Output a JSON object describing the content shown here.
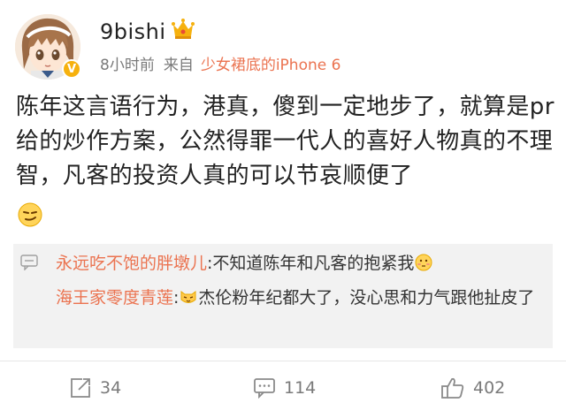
{
  "post": {
    "username": "9bishi",
    "time": "8小时前",
    "source_prefix": "来自",
    "source": "少女裙底的iPhone 6",
    "text": "陈年这言语行为，港真，傻到一定地步了，就算是pr给的炒作方案，公然得罪一代人的喜好人物真的不理智，凡客的投资人真的可以节哀顺便了",
    "emoji": "smirk-face-icon",
    "verified_badge": "V"
  },
  "comments": [
    {
      "user": "永远吃不饱的胖墩儿",
      "separator": ":",
      "text": "不知道陈年和凡客的抱紧我",
      "emoji_after": "embarrassed-face-icon"
    },
    {
      "user": "海王家零度青莲",
      "separator": ":",
      "emoji_before": "cat-face-icon",
      "text": "杰伦粉年纪都大了，没心思和力气跟他扯皮了"
    }
  ],
  "actions": {
    "repost_count": "34",
    "comment_count": "114",
    "like_count": "402"
  },
  "colors": {
    "accent": "#eb7350",
    "meta": "#7a7a7a",
    "comment_bg": "#f2f2f2",
    "verified": "#f6b10e"
  }
}
